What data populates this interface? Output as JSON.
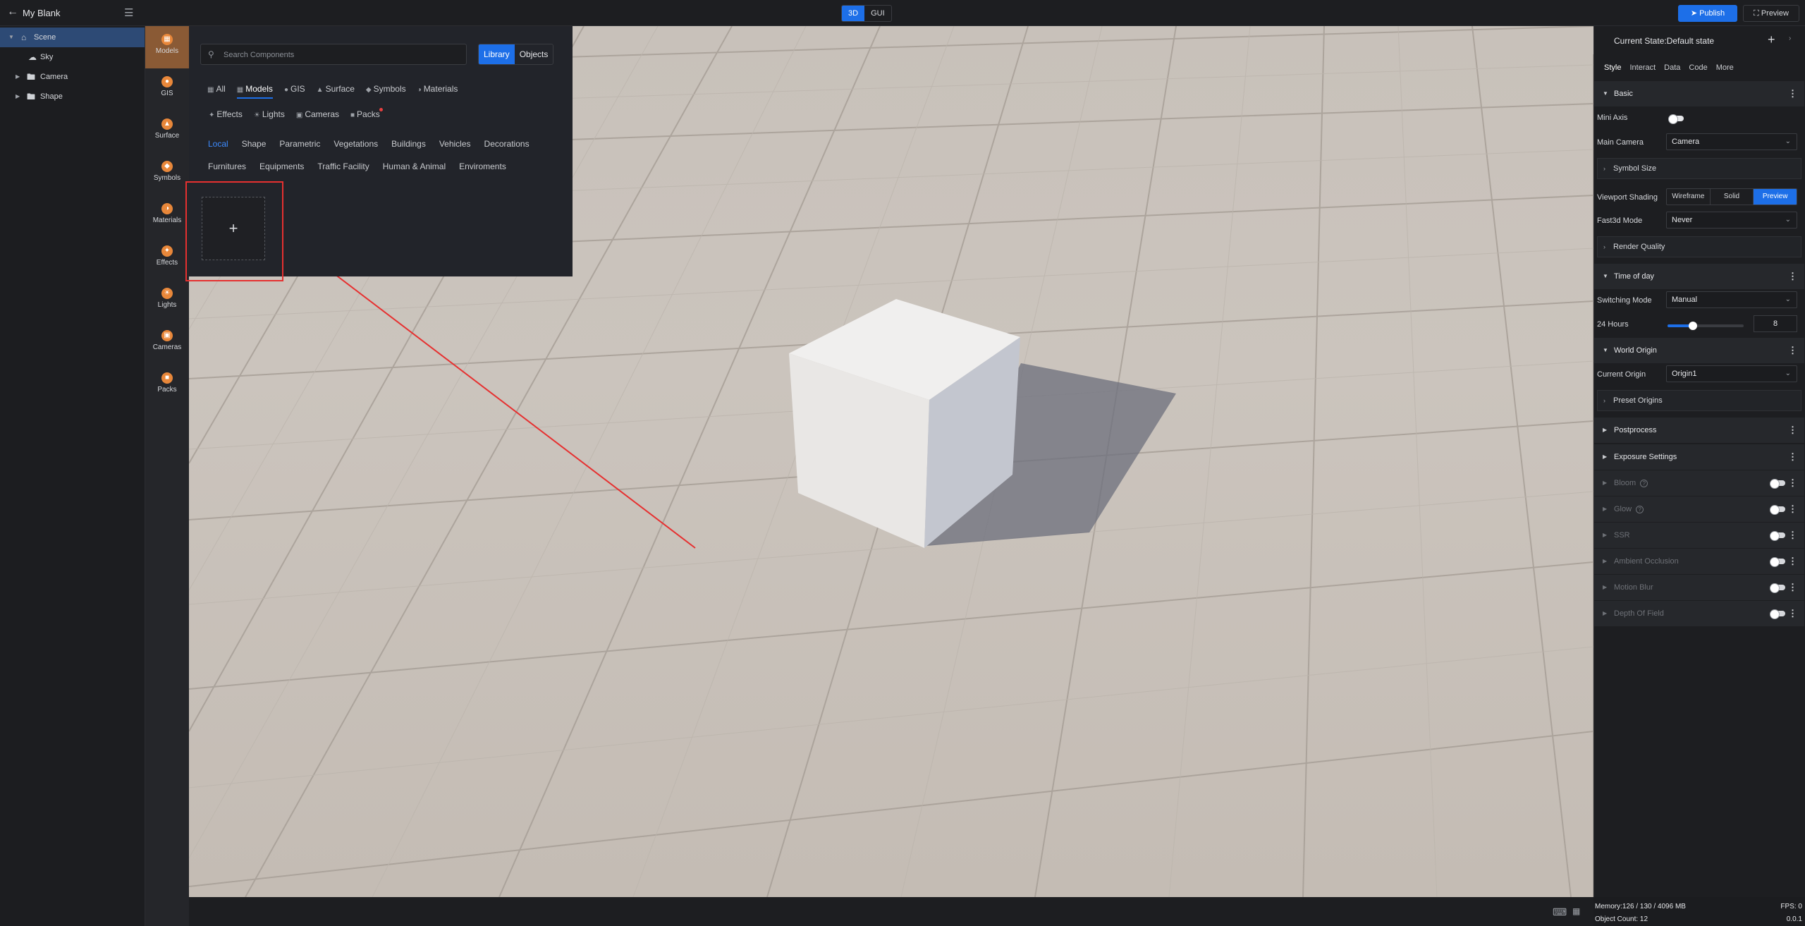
{
  "app": {
    "title": "My Blank"
  },
  "mode_switch": {
    "options": [
      "3D",
      "GUI"
    ],
    "active": "3D"
  },
  "actions": {
    "publish": "Publish",
    "preview": "Preview"
  },
  "tree": [
    {
      "label": "Scene",
      "selected": true,
      "expanded": true
    },
    {
      "label": "Sky"
    },
    {
      "label": "Camera"
    },
    {
      "label": "Shape"
    }
  ],
  "categories": [
    "Models",
    "GIS",
    "Surface",
    "Symbols",
    "Materials",
    "Effects",
    "Lights",
    "Cameras",
    "Packs"
  ],
  "library": {
    "search_placeholder": "Search Components",
    "toggle": [
      "Library",
      "Objects"
    ],
    "tabs_row1": [
      "All",
      "Models",
      "GIS",
      "Surface",
      "Symbols",
      "Materials"
    ],
    "tabs_row2": [
      "Effects",
      "Lights",
      "Cameras",
      "Packs"
    ],
    "sub_row1": [
      "Local",
      "Shape",
      "Parametric",
      "Vegetations",
      "Buildings",
      "Vehicles",
      "Decorations"
    ],
    "sub_row2": [
      "Furnitures",
      "Equipments",
      "Traffic Facility",
      "Human & Animal",
      "Enviroments"
    ],
    "add_symbol": "+"
  },
  "right": {
    "state_title": "Current State:Default state",
    "tabs": [
      "Style",
      "Interact",
      "Data",
      "Code",
      "More"
    ],
    "basic": "Basic",
    "mini_axis": "Mini Axis",
    "main_camera_label": "Main Camera",
    "main_camera_value": "Camera",
    "symbol_size": "Symbol Size",
    "viewport_shading_label": "Viewport Shading",
    "shading_options": [
      "Wireframe",
      "Solid",
      "Preview"
    ],
    "fast3d_label": "Fast3d Mode",
    "fast3d_value": "Never",
    "render_quality": "Render Quality",
    "time_of_day": "Time of day",
    "switching_mode_label": "Switching Mode",
    "switching_mode_value": "Manual",
    "hours_label": "24 Hours",
    "hours_value": "8",
    "hours_fraction": 0.33,
    "world_origin": "World Origin",
    "current_origin_label": "Current Origin",
    "current_origin_value": "Origin1",
    "preset_origins": "Preset Origins",
    "postprocess": "Postprocess",
    "exposure": "Exposure Settings",
    "effects": [
      "Bloom",
      "Glow",
      "SSR",
      "Ambient Occlusion",
      "Motion Blur",
      "Depth Of Field"
    ]
  },
  "status": {
    "memory": "Memory:126 / 130 / 4096 MB",
    "objects": "Object Count: 12",
    "fps": "FPS: 0",
    "version": "0.0.1"
  }
}
